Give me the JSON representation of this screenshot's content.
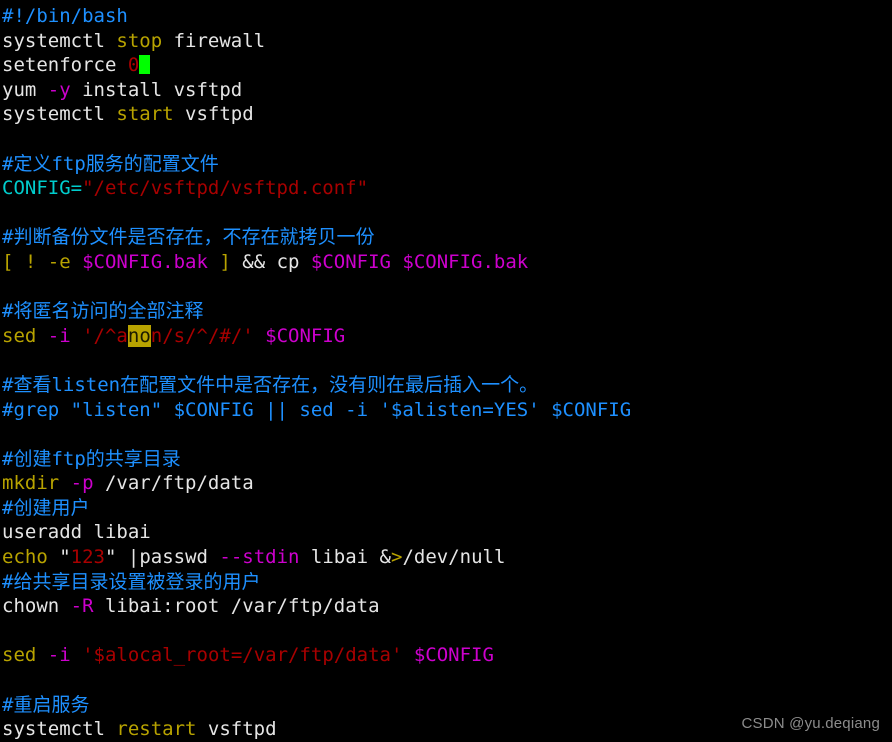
{
  "terminal": {
    "background_color": "#000000",
    "default_text_color": "#e5e5e5",
    "comment_color": "#1e90ff",
    "keyword_color": "#b8a300",
    "string_color": "#a80000",
    "variable_color": "#cd00cd",
    "assignment_color": "#00cdcd",
    "cursor_color": "#00ff00",
    "match_highlight_color": "#b8a300"
  },
  "script": {
    "lines": [
      {
        "id": "l1",
        "segments": [
          {
            "text": "#!/bin/bash",
            "style": "comment"
          }
        ]
      },
      {
        "id": "l2",
        "segments": [
          {
            "text": "systemctl ",
            "style": "default"
          },
          {
            "text": "stop",
            "style": "keyword"
          },
          {
            "text": " firewall",
            "style": "default"
          }
        ]
      },
      {
        "id": "l3",
        "segments": [
          {
            "text": "setenforce ",
            "style": "default"
          },
          {
            "text": "0",
            "style": "string"
          },
          {
            "text": "",
            "style": "cursor"
          }
        ]
      },
      {
        "id": "l4",
        "segments": [
          {
            "text": "yum ",
            "style": "default"
          },
          {
            "text": "-y",
            "style": "opt"
          },
          {
            "text": " install vsftpd",
            "style": "default"
          }
        ]
      },
      {
        "id": "l5",
        "segments": [
          {
            "text": "systemctl ",
            "style": "default"
          },
          {
            "text": "start",
            "style": "keyword"
          },
          {
            "text": " vsftpd",
            "style": "default"
          }
        ]
      },
      {
        "id": "l6",
        "segments": []
      },
      {
        "id": "l7",
        "segments": [
          {
            "text": "#定义ftp服务的配置文件",
            "style": "comment"
          }
        ]
      },
      {
        "id": "l8",
        "segments": [
          {
            "text": "CONFIG=",
            "style": "ident"
          },
          {
            "text": "\"/etc/vsftpd/vsftpd.conf\"",
            "style": "string"
          }
        ]
      },
      {
        "id": "l9",
        "segments": []
      },
      {
        "id": "l10",
        "segments": [
          {
            "text": "#判断备份文件是否存在，不存在就拷贝一份",
            "style": "comment"
          }
        ]
      },
      {
        "id": "l11",
        "segments": [
          {
            "text": "[ ! -e ",
            "style": "bracket"
          },
          {
            "text": "$CONFIG.bak",
            "style": "var"
          },
          {
            "text": " ]",
            "style": "bracket"
          },
          {
            "text": " && ",
            "style": "default"
          },
          {
            "text": "cp ",
            "style": "default"
          },
          {
            "text": "$CONFIG $CONFIG.bak",
            "style": "var"
          }
        ]
      },
      {
        "id": "l12",
        "segments": []
      },
      {
        "id": "l13",
        "segments": [
          {
            "text": "#将匿名访问的全部注释",
            "style": "comment"
          }
        ]
      },
      {
        "id": "l14",
        "segments": [
          {
            "text": "sed ",
            "style": "keyword"
          },
          {
            "text": "-i",
            "style": "opt"
          },
          {
            "text": " ",
            "style": "default"
          },
          {
            "text": "'/^a",
            "style": "string"
          },
          {
            "text": "no",
            "style": "match"
          },
          {
            "text": "n/s/^/#/'",
            "style": "string"
          },
          {
            "text": " ",
            "style": "default"
          },
          {
            "text": "$CONFIG",
            "style": "var"
          }
        ]
      },
      {
        "id": "l15",
        "segments": []
      },
      {
        "id": "l16",
        "segments": [
          {
            "text": "#查看listen在配置文件中是否存在，没有则在最后插入一个。",
            "style": "comment"
          }
        ]
      },
      {
        "id": "l17",
        "segments": [
          {
            "text": "#grep \"listen\" $CONFIG || sed -i '$alisten=YES' $CONFIG",
            "style": "comment"
          }
        ]
      },
      {
        "id": "l18",
        "segments": []
      },
      {
        "id": "l19",
        "segments": [
          {
            "text": "#创建ftp的共享目录",
            "style": "comment"
          }
        ]
      },
      {
        "id": "l20",
        "segments": [
          {
            "text": "mkdir ",
            "style": "keyword"
          },
          {
            "text": "-p",
            "style": "opt"
          },
          {
            "text": " /var/ftp/data",
            "style": "default"
          }
        ]
      },
      {
        "id": "l21",
        "segments": [
          {
            "text": "#创建用户",
            "style": "comment"
          }
        ]
      },
      {
        "id": "l22",
        "segments": [
          {
            "text": "useradd libai",
            "style": "default"
          }
        ]
      },
      {
        "id": "l23",
        "segments": [
          {
            "text": "echo",
            "style": "keyword"
          },
          {
            "text": " \"",
            "style": "default"
          },
          {
            "text": "123",
            "style": "string"
          },
          {
            "text": "\"",
            "style": "default"
          },
          {
            "text": " |passwd ",
            "style": "default"
          },
          {
            "text": "--stdin",
            "style": "opt"
          },
          {
            "text": " libai ",
            "style": "default"
          },
          {
            "text": "&",
            "style": "default"
          },
          {
            "text": ">",
            "style": "redir"
          },
          {
            "text": "/dev/null",
            "style": "default"
          }
        ]
      },
      {
        "id": "l24",
        "segments": [
          {
            "text": "#给共享目录设置被登录的用户",
            "style": "comment"
          }
        ]
      },
      {
        "id": "l25",
        "segments": [
          {
            "text": "chown ",
            "style": "default"
          },
          {
            "text": "-R",
            "style": "opt"
          },
          {
            "text": " libai:root /var/ftp/data",
            "style": "default"
          }
        ]
      },
      {
        "id": "l26",
        "segments": []
      },
      {
        "id": "l27",
        "segments": [
          {
            "text": "sed ",
            "style": "keyword"
          },
          {
            "text": "-i",
            "style": "opt"
          },
          {
            "text": " ",
            "style": "default"
          },
          {
            "text": "'$alocal_root=/var/ftp/data'",
            "style": "string"
          },
          {
            "text": " ",
            "style": "default"
          },
          {
            "text": "$CONFIG",
            "style": "var"
          }
        ]
      },
      {
        "id": "l28",
        "segments": []
      },
      {
        "id": "l29",
        "segments": [
          {
            "text": "#重启服务",
            "style": "comment"
          }
        ]
      },
      {
        "id": "l30",
        "segments": [
          {
            "text": "systemctl ",
            "style": "default"
          },
          {
            "text": "restart",
            "style": "keyword"
          },
          {
            "text": " vsftpd",
            "style": "default"
          }
        ]
      }
    ]
  },
  "watermark": {
    "text": "CSDN @yu.deqiang"
  }
}
